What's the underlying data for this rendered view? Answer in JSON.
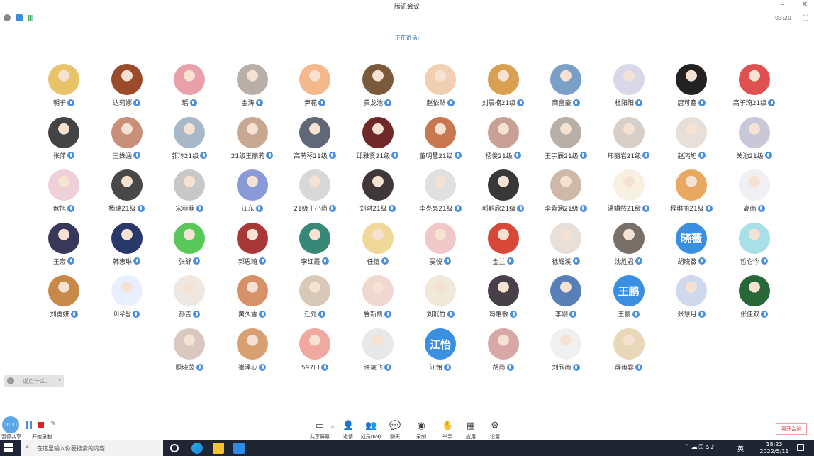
{
  "window": {
    "title": "腾讯会议"
  },
  "status": {
    "timer": "03:20"
  },
  "speaking": {
    "text": "正在讲话:"
  },
  "participants": [
    {
      "name": "明子",
      "c": "#e8c36a"
    },
    {
      "name": "达莉娜",
      "c": "#9b4a2a"
    },
    {
      "name": "瑶",
      "c": "#e9a0a8"
    },
    {
      "name": "金涛",
      "c": "#b8b0a8"
    },
    {
      "name": "尹花",
      "c": "#f4b88a"
    },
    {
      "name": "黄龙池",
      "c": "#7a5a3a"
    },
    {
      "name": "赵依然",
      "c": "#f0d0b0"
    },
    {
      "name": "刘晨楠21级",
      "c": "#d8a050"
    },
    {
      "name": "商富豪",
      "c": "#7aa0c8"
    },
    {
      "name": "杜阳阳",
      "c": "#d8d8e8"
    },
    {
      "name": "唐可鑫",
      "c": "#222222"
    },
    {
      "name": "高子琦21级",
      "c": "#e05050"
    },
    {
      "name": "张萍",
      "c": "#444444"
    },
    {
      "name": "王姝涵",
      "c": "#c89078"
    },
    {
      "name": "郭玲21级",
      "c": "#a8b8c8"
    },
    {
      "name": "21级王丽莉",
      "c": "#c8a890"
    },
    {
      "name": "高萌琴21级",
      "c": "#606878"
    },
    {
      "name": "邱雅贤21级",
      "c": "#702828"
    },
    {
      "name": "董明慧21级",
      "c": "#c87850"
    },
    {
      "name": "杨俊21级",
      "c": "#c8a098"
    },
    {
      "name": "王宇辰21级",
      "c": "#b8b0a8"
    },
    {
      "name": "邢丽岩21级",
      "c": "#d8d0c8"
    },
    {
      "name": "赵鸿旭",
      "c": "#e8e0d8"
    },
    {
      "name": "关池21级",
      "c": "#c8c8d8"
    },
    {
      "name": "歆旭",
      "c": "#f0d0d8"
    },
    {
      "name": "杨瑞21级",
      "c": "#484848"
    },
    {
      "name": "宋菲菲",
      "c": "#c8c8c8"
    },
    {
      "name": "江东",
      "c": "#8a9ad8"
    },
    {
      "name": "21级于小尚",
      "c": "#d8d8d8"
    },
    {
      "name": "刘琳21级",
      "c": "#403838"
    },
    {
      "name": "李亮亮21级",
      "c": "#e0e0e0"
    },
    {
      "name": "郭鹤欣21级",
      "c": "#383838"
    },
    {
      "name": "李紫涵21级",
      "c": "#d0b8a8"
    },
    {
      "name": "温娟然21级",
      "c": "#f8f0e0"
    },
    {
      "name": "程琳丽21级",
      "c": "#e8a860"
    },
    {
      "name": "高雨",
      "c": "#f0f0f4"
    },
    {
      "name": "王宏",
      "c": "#38385a"
    },
    {
      "name": "韩惠琳",
      "c": "#283868"
    },
    {
      "name": "张舒",
      "c": "#58c858"
    },
    {
      "name": "郭思琦",
      "c": "#a83838"
    },
    {
      "name": "李红霞",
      "c": "#388878"
    },
    {
      "name": "任倩",
      "c": "#f0d898"
    },
    {
      "name": "吴悦",
      "c": "#f0c8c8"
    },
    {
      "name": "金兰",
      "c": "#d84838"
    },
    {
      "name": "徐耀溪",
      "c": "#e8e0d8"
    },
    {
      "name": "沈胜君",
      "c": "#787068"
    },
    {
      "name": "胡晓薇",
      "text": "晓薇",
      "c": "#3a8fe0"
    },
    {
      "name": "哲仑今",
      "c": "#a8e0e8"
    },
    {
      "name": "刘勇妍",
      "c": "#c88848"
    },
    {
      "name": "이우람",
      "c": "#e8f0ff"
    },
    {
      "name": "孙吉",
      "c": "#f0e8e0"
    },
    {
      "name": "黄久雪",
      "c": "#d89068"
    },
    {
      "name": "迁处",
      "c": "#d8c8b8"
    },
    {
      "name": "鲁新凯",
      "c": "#f0d8d0"
    },
    {
      "name": "刘玳竹",
      "c": "#f0e8d8"
    },
    {
      "name": "冯惠敏",
      "c": "#484048"
    },
    {
      "name": "李刚",
      "c": "#5880b8"
    },
    {
      "name": "王鹏",
      "text": "王鹏",
      "c": "#3a8fe0"
    },
    {
      "name": "张慧月",
      "c": "#d0d8f0"
    },
    {
      "name": "张佳双",
      "c": "#286838"
    },
    {
      "name": "殷晓茵",
      "c": "#d8c8c0"
    },
    {
      "name": "崔泽心",
      "c": "#d8a070"
    },
    {
      "name": "597口",
      "c": "#f0a8a0"
    },
    {
      "name": "许凌飞",
      "c": "#e8e8e8"
    },
    {
      "name": "江怡",
      "text": "江怡",
      "c": "#3a8fe0"
    },
    {
      "name": "胡尚",
      "c": "#d8a8a8"
    },
    {
      "name": "刘欣雨",
      "c": "#f0f0f0"
    },
    {
      "name": "薛雨蓉",
      "c": "#e8d8b8"
    }
  ],
  "chat": {
    "placeholder": "说点什么..."
  },
  "recording": {
    "elapsed": "00:31",
    "label": "暂停共享",
    "start_label": "开始录制"
  },
  "toolbar": [
    {
      "label": "共享屏幕",
      "icon": "▭"
    },
    {
      "label": "邀请",
      "icon": "👤"
    },
    {
      "label": "成员(69)",
      "icon": "👥"
    },
    {
      "label": "聊天",
      "icon": "💬"
    },
    {
      "label": "录制",
      "icon": "◉"
    },
    {
      "label": "举手",
      "icon": "✋"
    },
    {
      "label": "应用",
      "icon": "▦"
    },
    {
      "label": "设置",
      "icon": "⚙"
    }
  ],
  "leave": {
    "label": "离开会议"
  },
  "taskbar": {
    "search_placeholder": "在这里输入你要搜索的内容",
    "ime": "英",
    "time": "18:23",
    "date": "2022/5/11"
  }
}
